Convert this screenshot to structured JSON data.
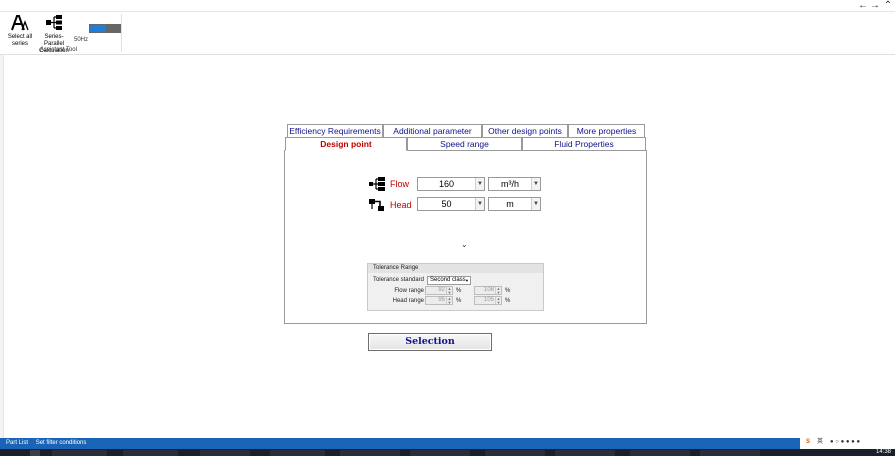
{
  "window": {
    "back_icon": "arrow-left-icon",
    "forward_icon": "arrow-right-icon",
    "collapse_icon": "chevron-up-icon"
  },
  "ribbon": {
    "tools": [
      {
        "label_line1": "Select all",
        "label_line2": "series",
        "icon": "font-a-icon"
      },
      {
        "label_line1": "Series-Parallel",
        "label_line2": "Calculation",
        "icon": "hierarchy-icon"
      }
    ],
    "frequency_label": "50Hz",
    "frequency_toggle_on": true,
    "group_label": "Assistant Tool"
  },
  "tabs": {
    "row1": [
      "Efficiency Requirements",
      "Additional parameter",
      "Other design points",
      "More properties"
    ],
    "row2": [
      "Design point",
      "Speed range",
      "Fluid Properties"
    ],
    "active": "Design point"
  },
  "design_point": {
    "flow": {
      "label": "Flow",
      "value": "160",
      "unit": "m³/h",
      "icon": "flow-icon"
    },
    "head": {
      "label": "Head",
      "value": "50",
      "unit": "m",
      "icon": "head-icon"
    },
    "expand_icon": "chevron-down-icon"
  },
  "tolerance": {
    "title": "Tolerance Range",
    "standard_label": "Tolerance standard",
    "standard_value": "Second class",
    "flow_label": "Flow range",
    "flow_min": "92",
    "flow_max": "108",
    "head_label": "Head range",
    "head_min": "95",
    "head_max": "105",
    "percent": "%"
  },
  "selection_button": "Selection",
  "status_bar": {
    "item1": "Part List",
    "item2": "Set filter conditions"
  },
  "taskbar": {
    "clock": "14:38",
    "ime": "英"
  },
  "colors": {
    "accent": "#c00000",
    "tab_text": "#12128a",
    "status_bar": "#1a64b7",
    "toggle_on": "#1f7ed6"
  }
}
